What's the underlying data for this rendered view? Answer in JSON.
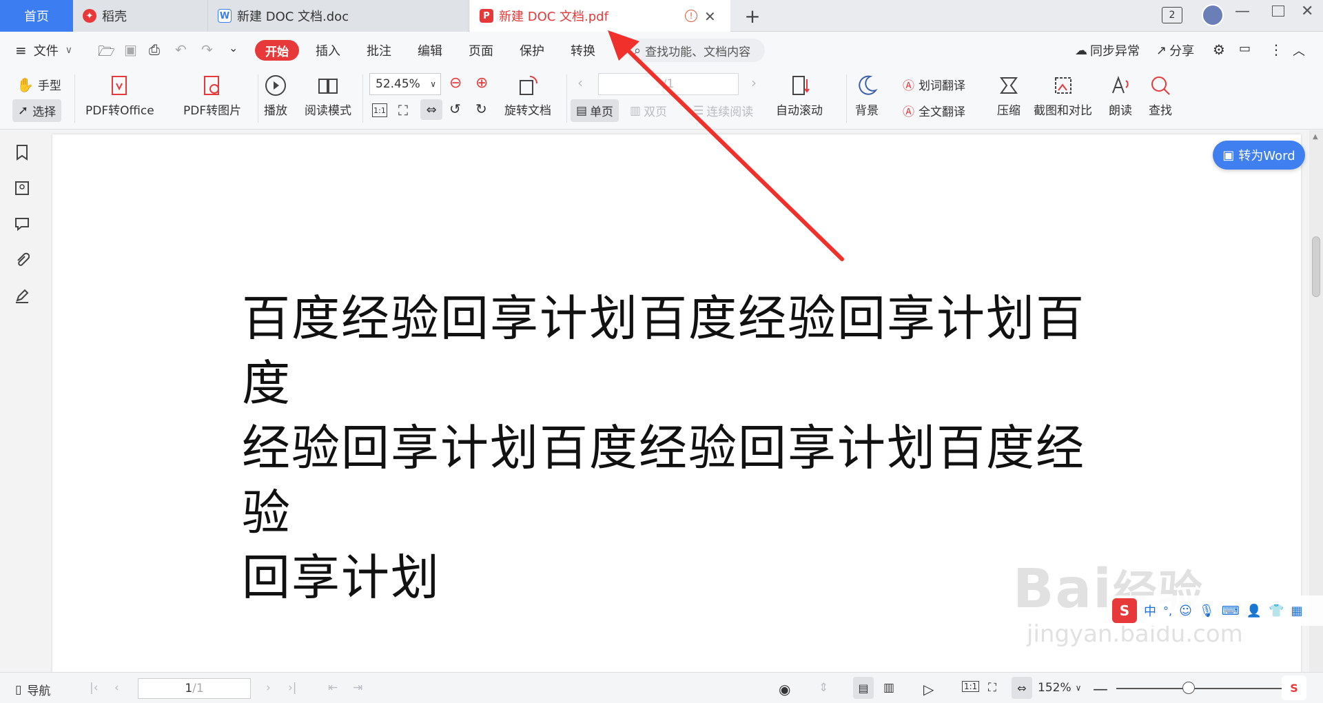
{
  "tabs": {
    "home": "首页",
    "daoke": "稻壳",
    "doc_tab": "新建 DOC 文档.doc",
    "pdf_tab": "新建 DOC 文档.pdf",
    "new_tab": "+"
  },
  "titlebar": {
    "window_count": "2"
  },
  "menu": {
    "file": "文件",
    "items": [
      "开始",
      "插入",
      "批注",
      "编辑",
      "页面",
      "保护",
      "转换"
    ],
    "search_placeholder": "查找功能、文档内容",
    "sync": "同步异常",
    "share": "分享"
  },
  "ribbon": {
    "hand": "手型",
    "select": "选择",
    "pdf_to_office": "PDF转Office",
    "pdf_to_image": "PDF转图片",
    "play": "播放",
    "read_mode": "阅读模式",
    "zoom": "52.45%",
    "rotate_doc": "旋转文档",
    "page_nav": "/1",
    "single_page": "单页",
    "double_page": "双页",
    "continuous": "连续阅读",
    "auto_scroll": "自动滚动",
    "background": "背景",
    "word_translate": "划词翻译",
    "full_translate": "全文翻译",
    "compress": "压缩",
    "screenshot_compare": "截图和对比",
    "read_aloud": "朗读",
    "find": "查找"
  },
  "document": {
    "lines": [
      "百度经验回享计划百度经验回享计划百度",
      "经验回享计划百度经验回享计划百度经验",
      "回享计划"
    ],
    "to_word": "转为Word"
  },
  "statusbar": {
    "nav": "导航",
    "page_current": "1",
    "page_total": "/1",
    "zoom": "152%"
  },
  "watermark": {
    "brand": "Bai",
    "brand_cn": "经验",
    "url": "jingyan.baidu.com"
  },
  "colors": {
    "accent_blue": "#3c7ef1",
    "accent_red": "#e8393a",
    "annotation_arrow": "#f0302a"
  }
}
